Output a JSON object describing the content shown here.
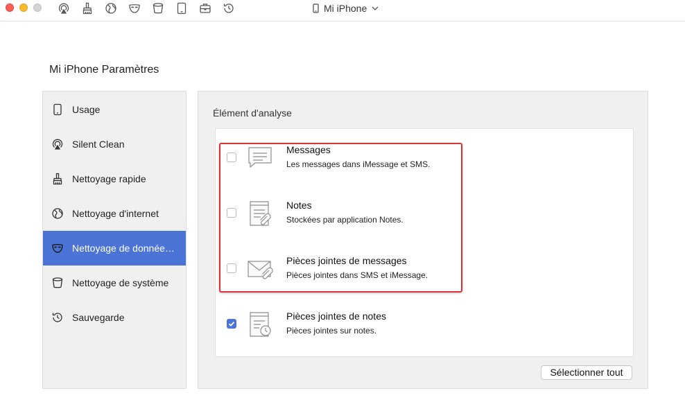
{
  "window": {
    "device_name": "Mi iPhone",
    "toolbar_icons": [
      "airplay-icon",
      "brush-icon",
      "globe-icon",
      "mask-icon",
      "bucket-icon",
      "tablet-icon",
      "briefcase-icon",
      "history-icon"
    ]
  },
  "page": {
    "title": "Mi iPhone Paramètres"
  },
  "sidebar": {
    "items": [
      {
        "label": "Usage",
        "icon": "phone-icon",
        "active": false
      },
      {
        "label": "Silent Clean",
        "icon": "airplay-icon",
        "active": false
      },
      {
        "label": "Nettoyage rapide",
        "icon": "brush-icon",
        "active": false
      },
      {
        "label": "Nettoyage d'internet",
        "icon": "globe-icon",
        "active": false
      },
      {
        "label": "Nettoyage de donnée…",
        "icon": "mask-icon",
        "active": true
      },
      {
        "label": "Nettoyage de système",
        "icon": "bucket-icon",
        "active": false
      },
      {
        "label": "Sauvegarde",
        "icon": "history-icon",
        "active": false
      }
    ],
    "accent_color": "#4b74d6"
  },
  "main": {
    "section_title": "Élément d'analyse",
    "items": [
      {
        "title": "Messages",
        "subtitle": "Les messages dans iMessage et SMS.",
        "checked": false,
        "icon": "message-bubble-icon"
      },
      {
        "title": "Notes",
        "subtitle": "Stockées par application Notes.",
        "checked": false,
        "icon": "note-attachment-icon"
      },
      {
        "title": "Pièces jointes de messages",
        "subtitle": "Pièces jointes dans SMS et iMessage.",
        "checked": false,
        "icon": "envelope-attachment-icon"
      },
      {
        "title": "Pièces jointes de notes",
        "subtitle": "Pièces jointes sur notes.",
        "checked": true,
        "icon": "note-clock-icon"
      }
    ],
    "select_all_label": "Sélectionner tout",
    "highlight_color": "#d9333a"
  }
}
